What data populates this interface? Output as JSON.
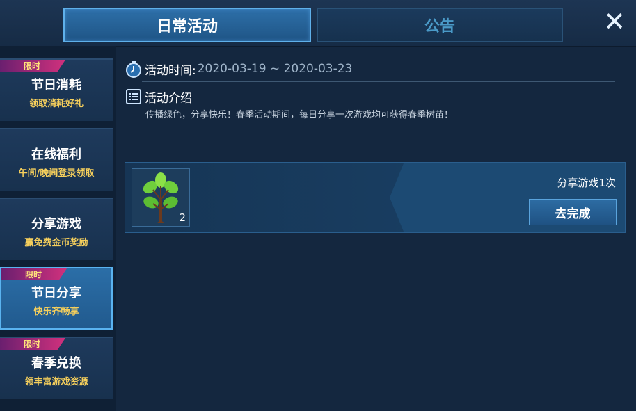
{
  "tabs": {
    "daily": "日常活动",
    "notice": "公告"
  },
  "close_icon": "close-icon",
  "sidebar": {
    "items": [
      {
        "badge": "限时",
        "title": "节日消耗",
        "subtitle": "领取消耗好礼"
      },
      {
        "badge": "",
        "title": "在线福利",
        "subtitle": "午间/晚间登录领取"
      },
      {
        "badge": "",
        "title": "分享游戏",
        "subtitle": "赢免费金币奖励"
      },
      {
        "badge": "限时",
        "title": "节日分享",
        "subtitle": "快乐齐畅享"
      },
      {
        "badge": "限时",
        "title": "春季兑换",
        "subtitle": "领丰富游戏资源"
      }
    ],
    "active_index": 3
  },
  "activity": {
    "time_label": "活动时间:",
    "time_value": "2020-03-19 ~ 2020-03-23",
    "intro_label": "活动介绍",
    "intro_text": "传播绿色，分享快乐！春季活动期间，每日分享一次游戏均可获得春季树苗！"
  },
  "task": {
    "reward_icon": "sapling-icon",
    "reward_count": "2",
    "name": "分享游戏1次",
    "button": "去完成"
  },
  "colors": {
    "background": "#14273f",
    "badge": "#d1317d",
    "subtitle": "#f5cf5c",
    "active": "#2b6ea7"
  }
}
